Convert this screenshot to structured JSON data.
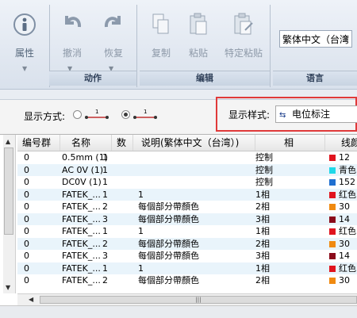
{
  "ribbon": {
    "properties_label": "属性",
    "undo_label": "撤消",
    "redo_label": "恢复",
    "action_group": "动作",
    "copy_label": "复制",
    "paste_label": "粘贴",
    "paste_special_label": "特定粘贴",
    "edit_group": "编辑",
    "language_value": "繁体中文（台湾",
    "language_group": "语言"
  },
  "options": {
    "display_mode_label": "显示方式:",
    "display_style_label": "显示样式:",
    "display_style_value": "电位标注"
  },
  "table": {
    "columns": [
      "编号群",
      "名称",
      "数",
      "说明(繁体中文（台湾）)",
      "相",
      "线颜"
    ],
    "rows": [
      {
        "group": "0",
        "name": "0.5mm (1)",
        "num": "1",
        "desc": "",
        "phase": "控制",
        "color": "12",
        "swatch": "#e0141e"
      },
      {
        "group": "0",
        "name": "AC 0V (1)",
        "num": "1",
        "desc": "",
        "phase": "控制",
        "color": "青色",
        "swatch": "#20d8e8"
      },
      {
        "group": "0",
        "name": "DC0V (1)",
        "num": "1",
        "desc": "",
        "phase": "控制",
        "color": "152",
        "swatch": "#1f6fd0"
      },
      {
        "group": "0",
        "name": "FATEK_...",
        "num": "1",
        "desc": "1",
        "phase": "1相",
        "color": "红色",
        "swatch": "#e0141e"
      },
      {
        "group": "0",
        "name": "FATEK_...",
        "num": "2",
        "desc": "每個部分帶顏色",
        "phase": "2相",
        "color": "30",
        "swatch": "#f08a10"
      },
      {
        "group": "0",
        "name": "FATEK_...",
        "num": "3",
        "desc": "每個部分帶顏色",
        "phase": "3相",
        "color": "14",
        "swatch": "#8a0a1a"
      },
      {
        "group": "0",
        "name": "FATEK_...",
        "num": "1",
        "desc": "1",
        "phase": "1相",
        "color": "红色",
        "swatch": "#e0141e"
      },
      {
        "group": "0",
        "name": "FATEK_...",
        "num": "2",
        "desc": "每個部分帶顏色",
        "phase": "2相",
        "color": "30",
        "swatch": "#f08a10"
      },
      {
        "group": "0",
        "name": "FATEK_...",
        "num": "3",
        "desc": "每個部分帶顏色",
        "phase": "3相",
        "color": "14",
        "swatch": "#8a0a1a"
      },
      {
        "group": "0",
        "name": "FATEK_...",
        "num": "1",
        "desc": "1",
        "phase": "1相",
        "color": "红色",
        "swatch": "#e0141e"
      },
      {
        "group": "0",
        "name": "FATEK_...",
        "num": "2",
        "desc": "每個部分帶顏色",
        "phase": "2相",
        "color": "30",
        "swatch": "#f08a10"
      }
    ]
  },
  "accent_colors": {
    "highlight_box": "#e03a3a",
    "row_alt": "#e9f4fb"
  },
  "icons": [
    "info-icon",
    "undo-icon",
    "redo-icon",
    "copy-icon",
    "paste-icon",
    "paste-special-icon",
    "wire-icon",
    "potential-marker-icon"
  ]
}
